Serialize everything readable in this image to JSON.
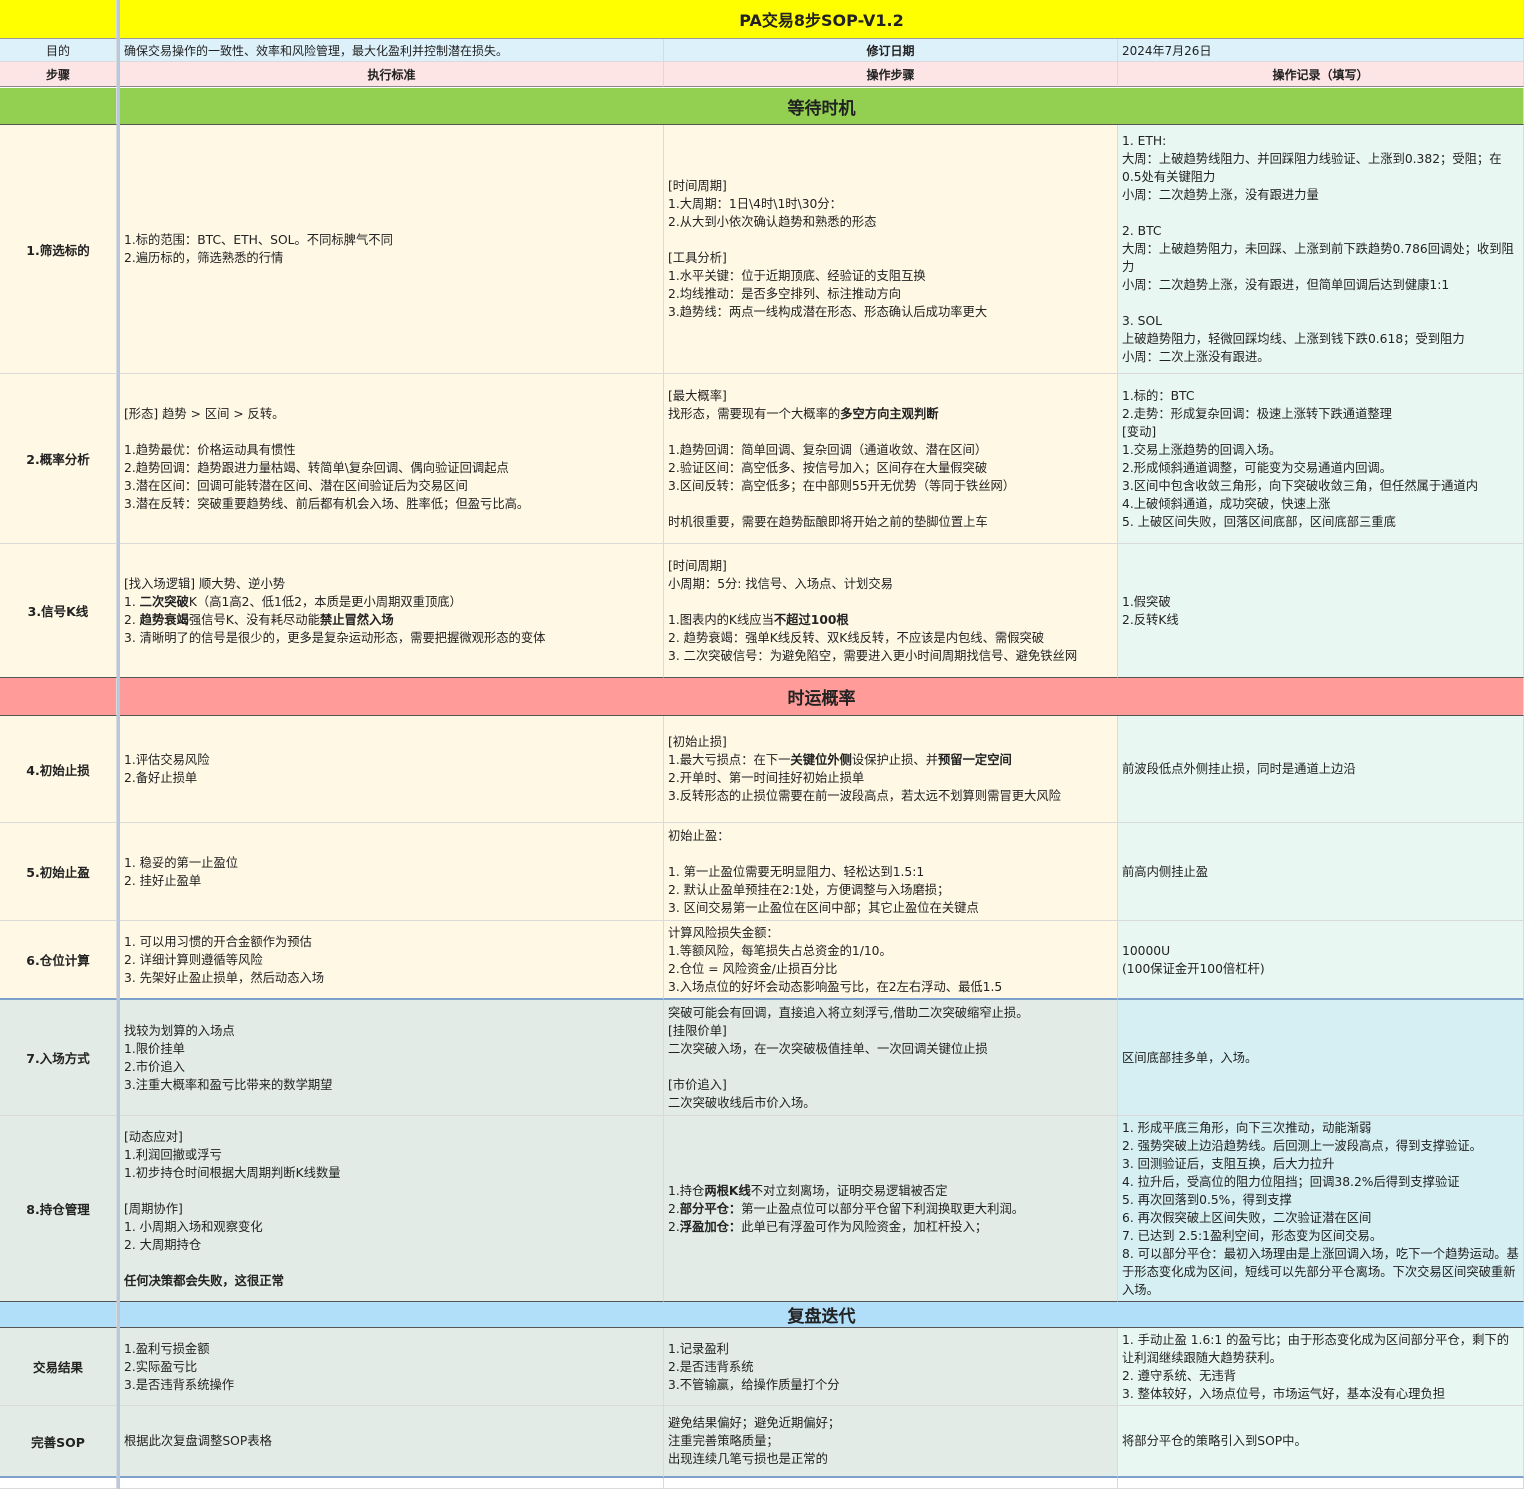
{
  "title": "PA交易8步SOP-V1.2",
  "meta": {
    "purpose_label": "目的",
    "purpose_value": "确保交易操作的一致性、效率和风险管理，最大化盈利并控制潜在损失。",
    "date_label": "修订日期",
    "date_value": "2024年7月26日"
  },
  "header": {
    "step": "步骤",
    "standard": "执行标准",
    "operation": "操作步骤",
    "record": "操作记录（填写）"
  },
  "sections": {
    "s1": "等待时机",
    "s2": "时运概率",
    "s3": "复盘迭代"
  },
  "rows": {
    "r1": {
      "step": "1.筛选标的",
      "standard": "1.标的范围：BTC、ETH、SOL。不同标脾气不同\n2.遍历标的，筛选熟悉的行情",
      "operation": "[时间周期]\n1.大周期：1日\\4时\\1时\\30分：\n2.从大到小依次确认趋势和熟悉的形态\n\n[工具分析]\n1.水平关键：位于近期顶底、经验证的支阻互换\n2.均线推动：是否多空排列、标注推动方向\n3.趋势线：两点一线构成潜在形态、形态确认后成功率更大",
      "record": "1. ETH:\n大周：上破趋势线阻力、并回踩阻力线验证、上涨到0.382；受阻；在0.5处有关键阻力\n小周：二次趋势上涨，没有跟进力量\n\n2. BTC\n大周：上破趋势阻力，未回踩、上涨到前下跌趋势0.786回调处；收到阻力\n小周：二次趋势上涨，没有跟进，但简单回调后达到健康1:1\n\n3. SOL\n上破趋势阻力，轻微回踩均线、上涨到钱下跌0.618；受到阻力\n小周：二次上涨没有跟进。"
    },
    "r2": {
      "step": "2.概率分析",
      "standard": "[形态] 趋势 > 区间 > 反转。\n\n1.趋势最优：价格运动具有惯性\n2.趋势回调：趋势跟进力量枯竭、转简单\\复杂回调、偶向验证回调起点\n3.潜在区间：回调可能转潜在区间、潜在区间验证后为交易区间\n3.潜在反转：突破重要趋势线、前后都有机会入场、胜率低；但盈亏比高。",
      "op_a": "[最大概率]\n找形态，需要现有一个大概率的",
      "op_b": "多空方向主观判断",
      "op_c": "\n\n1.趋势回调：简单回调、复杂回调（通道收敛、潜在区间）\n2.验证区间：高空低多、按信号加入；区间存在大量假突破\n3.区间反转：高空低多；在中部则55开无优势（等同于铁丝网）\n\n时机很重要，需要在趋势酝酿即将开始之前的垫脚位置上车",
      "record": "1.标的：BTC\n2.走势：形成复杂回调：极速上涨转下跌通道整理\n[变动]\n1.交易上涨趋势的回调入场。\n2.形成倾斜通道调整，可能变为交易通道内回调。\n3.区间中包含收敛三角形，向下突破收敛三角，但任然属于通道内\n4.上破倾斜通道，成功突破，快速上涨\n5. 上破区间失败，回落区间底部，区间底部三重底"
    },
    "r3": {
      "step": "3.信号K线",
      "st_a": "[找入场逻辑] 顺大势、逆小势\n1. ",
      "st_b": "二次突破",
      "st_c": "K（高1高2、低1低2，本质是更小周期双重顶底）\n2. ",
      "st_d": "趋势衰竭",
      "st_e": "强信号K、没有耗尽动能",
      "st_f": "禁止冒然入场",
      "st_g": "\n3. 清晰明了的信号是很少的，更多是复杂运动形态，需要把握微观形态的变体",
      "op_a": "[时间周期]\n小周期：5分: 找信号、入场点、计划交易\n\n1.图表内的K线应当",
      "op_b": "不超过100根",
      "op_c": "\n2. 趋势衰竭：强单K线反转、双K线反转，不应该是内包线、需假突破\n3. 二次突破信号：为避免陷空，需要进入更小时间周期找信号、避免铁丝网",
      "record": "1.假突破\n2.反转K线"
    },
    "r4": {
      "step": "4.初始止损",
      "standard": "1.评估交易风险\n2.备好止损单",
      "op_a": "[初始止损]\n1.最大亏损点：在下一",
      "op_b": "关键位外侧",
      "op_c": "设保护止损、并",
      "op_d": "预留一定空间",
      "op_e": "\n2.开单时、第一时间挂好初始止损单\n3.反转形态的止损位需要在前一波段高点，若太远不划算则需冒更大风险",
      "record": "前波段低点外侧挂止损，同时是通道上边沿"
    },
    "r5": {
      "step": "5.初始止盈",
      "standard": "1. 稳妥的第一止盈位\n2. 挂好止盈单",
      "operation": "初始止盈：\n\n1. 第一止盈位需要无明显阻力、轻松达到1.5:1\n2. 默认止盈单预挂在2:1处，方便调整与入场磨损；\n3. 区间交易第一止盈位在区间中部；其它止盈位在关键点",
      "record": "前高内侧挂止盈"
    },
    "r6": {
      "step": "6.仓位计算",
      "standard": "1. 可以用习惯的开合金额作为预估\n2. 详细计算则遵循等风险\n3. 先架好止盈止损单，然后动态入场",
      "operation": "计算风险损失金额：\n1.等额风险，每笔损失占总资金的1/10。\n2.仓位 = 风险资金/止损百分比\n3.入场点位的好坏会动态影响盈亏比，在2左右浮动、最低1.5",
      "record": "10000U\n(100保证金开100倍杠杆)"
    },
    "r7": {
      "step": "7.入场方式",
      "standard": "找较为划算的入场点\n1.限价挂单\n2.市价追入\n3.注重大概率和盈亏比带来的数学期望",
      "operation": "突破可能会有回调，直接追入将立刻浮亏,借助二次突破缩窄止损。\n[挂限价单]\n二次突破入场，在一次突破极值挂单、一次回调关键位止损\n\n[市价追入]\n二次突破收线后市价入场。",
      "record": "区间底部挂多单，入场。"
    },
    "r8": {
      "step": "8.持仓管理",
      "st_a": "[动态应对]\n1.利润回撤或浮亏\n1.初步持仓时间根据大周期判断K线数量\n\n[周期协作]\n1. 小周期入场和观察变化\n2. 大周期持仓\n\n",
      "st_b": "任何决策都会失败，这很正常",
      "op_a": "1.持仓",
      "op_b": "两根K线",
      "op_c": "不对立刻离场，证明交易逻辑被否定\n2.",
      "op_d": "部分平仓：",
      "op_e": "第一止盈点位可以部分平仓留下利润换取更大利润。\n2.",
      "op_f": "浮盈加仓：",
      "op_g": "此单已有浮盈可作为风险资金，加杠杆投入；",
      "record": "1. 形成平底三角形，向下三次推动，动能渐弱\n2. 强势突破上边沿趋势线。后回测上一波段高点，得到支撑验证。\n3. 回测验证后，支阻互换，后大力拉升\n4. 拉升后，受高位的阻力位阻挡；回调38.2%后得到支撑验证\n5. 再次回落到0.5%，得到支撑\n6. 再次假突破上区间失败，二次验证潜在区间\n7. 已达到 2.5:1盈利空间，形态变为区间交易。\n8. 可以部分平仓：最初入场理由是上涨回调入场，吃下一个趋势运动。基于形态变化成为区间，短线可以先部分平仓离场。下次交易区间突破重新入场。"
    },
    "r9": {
      "step": "交易结果",
      "standard": "1.盈利亏损金额\n2.实际盈亏比\n3.是否违背系统操作",
      "operation": "1.记录盈利\n2.是否违背系统\n3.不管输赢，给操作质量打个分",
      "record": "1. 手动止盈 1.6:1 的盈亏比；由于形态变化成为区间部分平仓，剩下的让利润继续跟随大趋势获利。\n2. 遵守系统、无违背\n3. 整体较好，入场点位号，市场运气好，基本没有心理负担"
    },
    "r10": {
      "step": "完善SOP",
      "standard": "根据此次复盘调整SOP表格",
      "operation": "避免结果偏好；避免近期偏好；\n注重完善策略质量；\n出现连续几笔亏损也是正常的",
      "record": "将部分平仓的策略引入到SOP中。"
    }
  },
  "colors": {
    "title_bg": "#ffff00",
    "meta_bg": "#ddf1fb",
    "header_bg": "#fde4e5",
    "section1_bg": "#93d051",
    "section2_bg": "#ff9c99",
    "section3_bg": "#b1def9",
    "cream_bg": "#fff8e5",
    "mint_bg": "#e9f7f2",
    "gray_green_bg": "#e3ebe6",
    "light_teal_bg": "#d5eff2"
  }
}
